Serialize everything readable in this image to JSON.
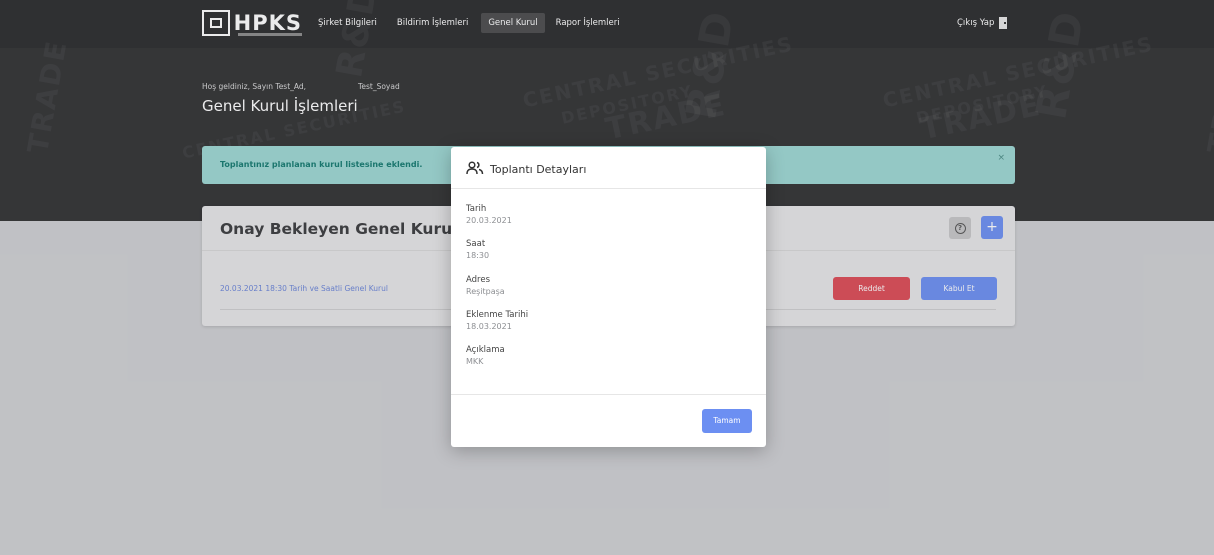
{
  "brand": {
    "name": "HPKS"
  },
  "nav": {
    "items": [
      {
        "label": "Şirket Bilgileri",
        "active": false
      },
      {
        "label": "Bildirim İşlemleri",
        "active": false
      },
      {
        "label": "Genel Kurul",
        "active": true
      },
      {
        "label": "Rapor İşlemleri",
        "active": false
      }
    ],
    "logout_label": "Çıkış Yap"
  },
  "header": {
    "welcome": "Hoş geldiniz, Sayın Test_Ad,",
    "surname": "Test_Soyad",
    "page_title": "Genel Kurul İşlemleri"
  },
  "alert": {
    "message": "Toplantınız planlanan kurul listesine eklendi.",
    "close": "×"
  },
  "card": {
    "title": "Onay Bekleyen Genel Kurul Listesi",
    "help_icon": "?",
    "add_label": "+",
    "rows": [
      {
        "text": "20.03.2021 18:30 Tarih ve Saatli Genel Kurul",
        "reject_label": "Reddet",
        "accept_label": "Kabul Et"
      }
    ]
  },
  "modal": {
    "title": "Toplantı Detayları",
    "fields": [
      {
        "label": "Tarih",
        "value": "20.03.2021"
      },
      {
        "label": "Saat",
        "value": "18:30"
      },
      {
        "label": "Adres",
        "value": "Reşitpaşa"
      },
      {
        "label": "Eklenme Tarihi",
        "value": "18.03.2021"
      },
      {
        "label": "Açıklama",
        "value": "MKK"
      }
    ],
    "ok_label": "Tamam"
  },
  "colors": {
    "header_bg": "#303132",
    "accent": "#6c8ff2",
    "danger": "#dc4a55",
    "alert_bg": "#9dd8d3",
    "alert_text": "#137a70"
  },
  "watermark": [
    "CENTRAL SECURITIES",
    "DEPOSITORY",
    "TRADE",
    "R&D"
  ]
}
